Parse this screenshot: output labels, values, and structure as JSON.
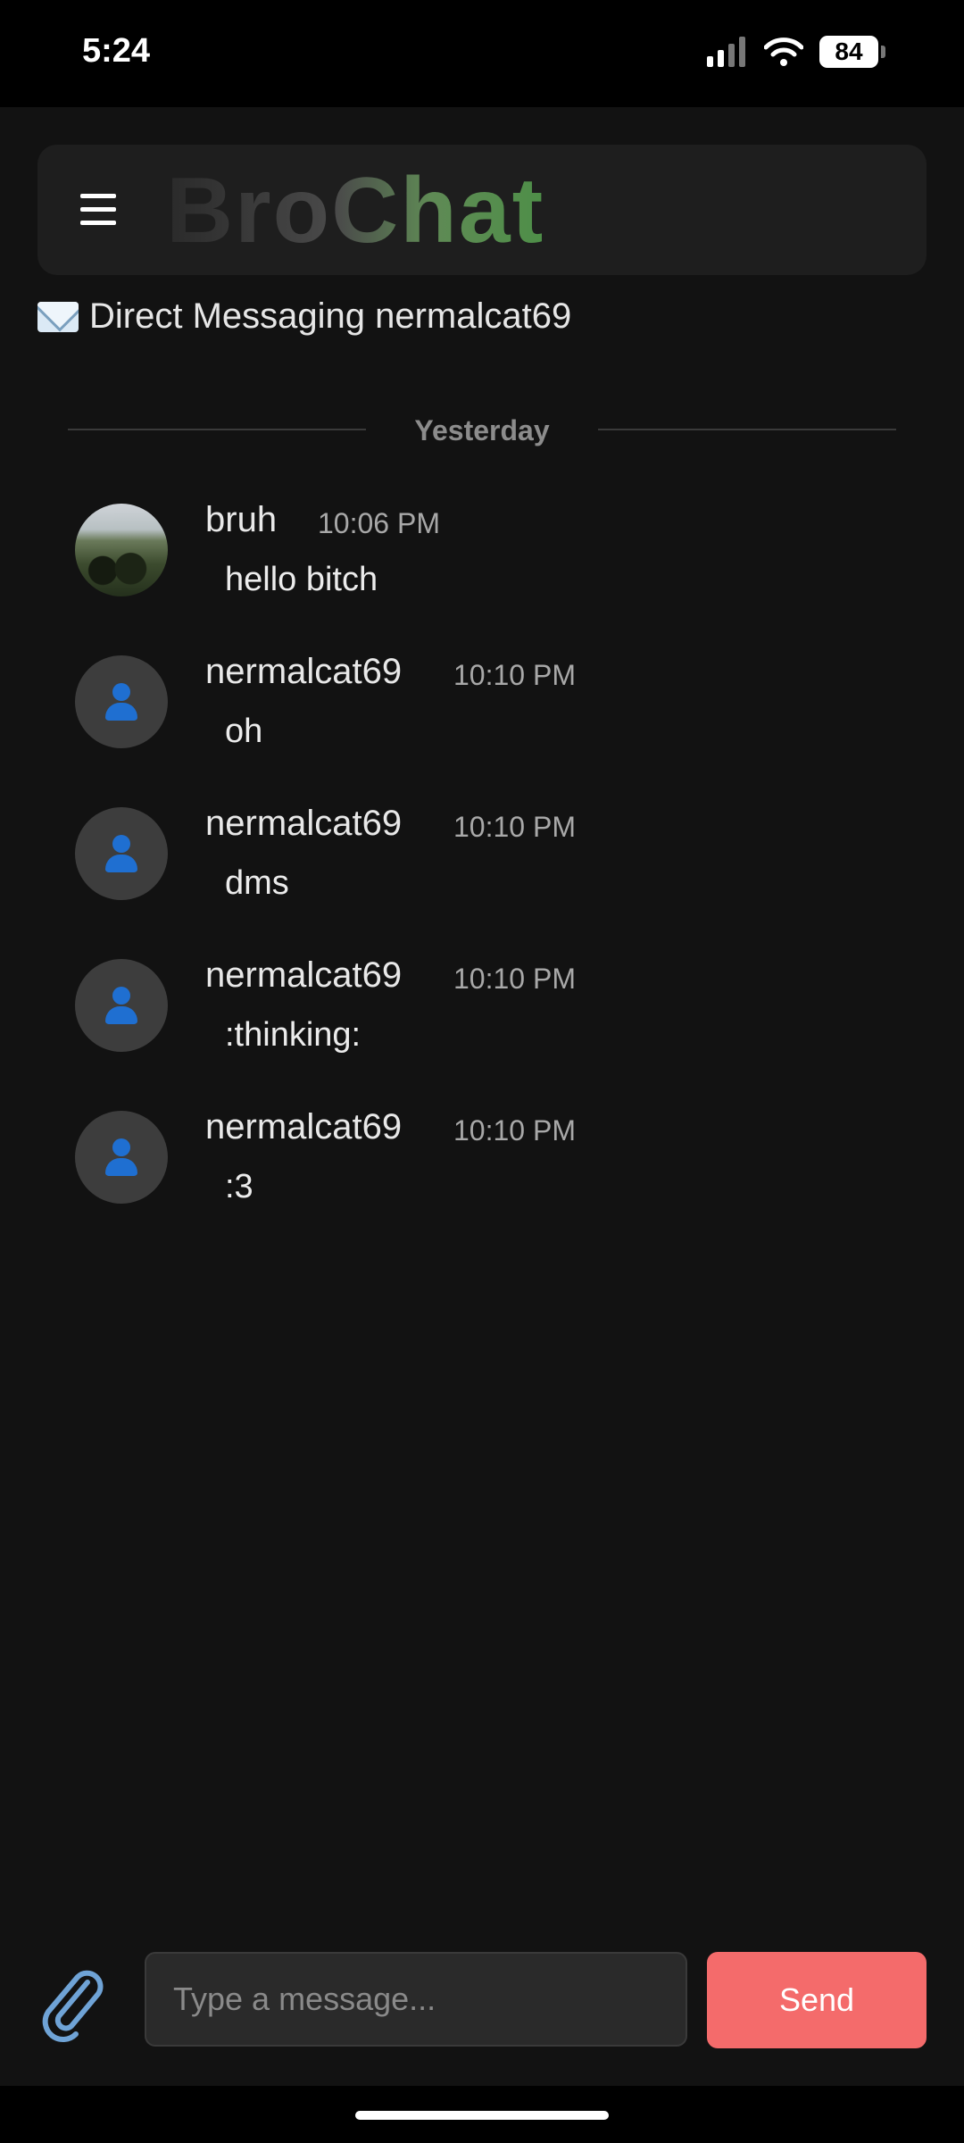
{
  "status_bar": {
    "time": "5:24",
    "battery": "84"
  },
  "header": {
    "brand": "BroChat"
  },
  "dm": {
    "label": "Direct Messaging nermalcat69"
  },
  "divider": {
    "label": "Yesterday"
  },
  "messages": [
    {
      "author": "bruh",
      "time": "10:06 PM",
      "text": "hello bitch",
      "avatar": "photo"
    },
    {
      "author": "nermalcat69",
      "time": "10:10 PM",
      "text": "oh",
      "avatar": "default-user-icon"
    },
    {
      "author": "nermalcat69",
      "time": "10:10 PM",
      "text": "dms",
      "avatar": "default-user-icon"
    },
    {
      "author": "nermalcat69",
      "time": "10:10 PM",
      "text": ":thinking:",
      "avatar": "default-user-icon"
    },
    {
      "author": "nermalcat69",
      "time": "10:10 PM",
      "text": ":3",
      "avatar": "default-user-icon"
    }
  ],
  "composer": {
    "placeholder": "Type a message...",
    "send_label": "Send"
  },
  "colors": {
    "background": "#121212",
    "send": "#f46b6b",
    "brand_green": "#4e8f48",
    "avatar_icon": "#1f6fd1"
  }
}
